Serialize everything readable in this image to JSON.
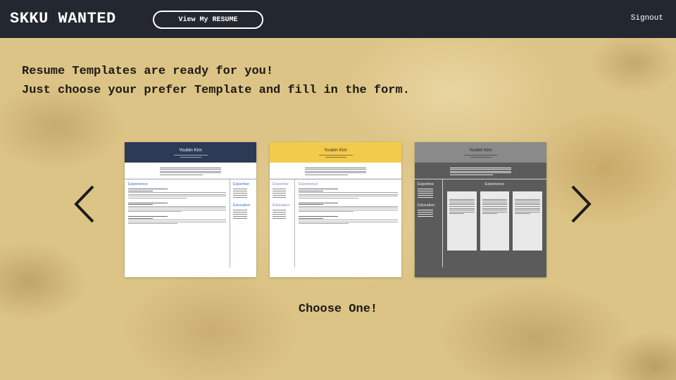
{
  "header": {
    "brand": "SKKU WANTED",
    "resume_button_label": "View My RESUME",
    "signout_label": "Signout"
  },
  "headline": {
    "line1": "Resume Templates are ready for you!",
    "line2": "Just choose your prefer Template and fill in the form."
  },
  "templates": [
    {
      "name": "Youbin Kim",
      "header_color": "#2d3a55",
      "sections": {
        "experience": "Experience",
        "expertise": "Expertise",
        "education": "Education"
      }
    },
    {
      "name": "Youbin Kim",
      "header_color": "#f3cb4c",
      "sections": {
        "expertise": "Expertise",
        "education": "Education",
        "experience": "Experience"
      }
    },
    {
      "name": "Youbin Kim",
      "header_color": "#8a8a8a",
      "sections": {
        "expertise": "Expertise",
        "education": "Education",
        "experience": "Experience"
      }
    }
  ],
  "carousel": {
    "prev_icon": "chevron-left-icon",
    "next_icon": "chevron-right-icon"
  },
  "prompt": "Choose One!"
}
